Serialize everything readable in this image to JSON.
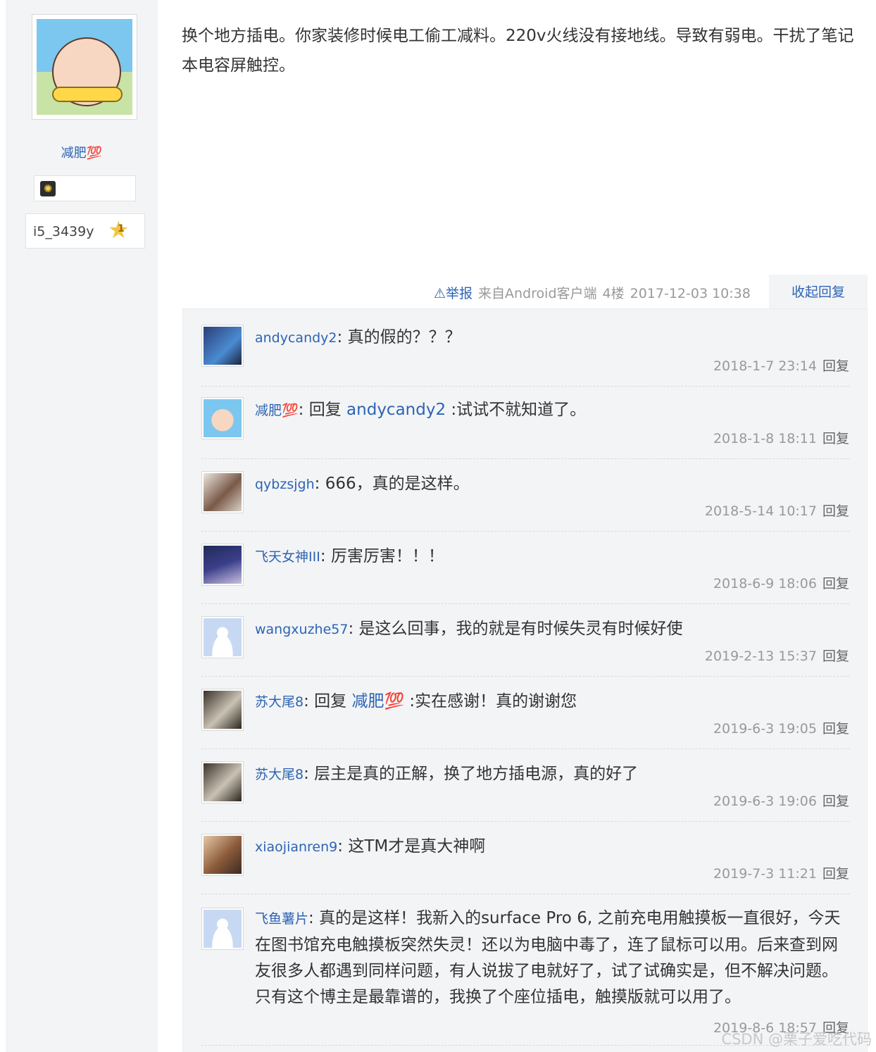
{
  "user": {
    "name": "减肥💯",
    "level_id": "i5_3439y",
    "level_number": "1"
  },
  "post": {
    "content": "换个地方插电。你家装修时候电工偷工减料。220v火线没有接地线。导致有弱电。干扰了笔记本电容屏触控。",
    "report_label": "⚠举报",
    "source": "来自Android客户端",
    "floor": "4楼",
    "time": "2017-12-03 10:38",
    "collapse_label": "收起回复"
  },
  "reply_label": "回复",
  "replies": [
    {
      "user": "andycandy2",
      "prefix": "",
      "target": "",
      "text": "真的假的？？？",
      "time": "2018-1-7 23:14",
      "colors": [
        "#2b3e78",
        "#4a8bd1"
      ]
    },
    {
      "user": "减肥💯",
      "prefix": "回复 ",
      "target": "andycandy2",
      "text": " :试试不就知道了。",
      "time": "2018-1-8 18:11",
      "colors": [
        "#7cc7ef",
        "#f7d7c2"
      ]
    },
    {
      "user": "qybzsjgh",
      "prefix": "",
      "target": "",
      "text": "666，真的是这样。",
      "time": "2018-5-14 10:17",
      "colors": [
        "#d9d0c8",
        "#7a5a48"
      ]
    },
    {
      "user": "飞天女神III",
      "prefix": "",
      "target": "",
      "text": "厉害厉害！！！",
      "time": "2018-6-9 18:06",
      "colors": [
        "#1f2a5a",
        "#c9c1e0"
      ]
    },
    {
      "user": "wangxuzhe57",
      "prefix": "",
      "target": "",
      "text": "是这么回事，我的就是有时候失灵有时候好使",
      "time": "2019-2-13 15:37",
      "colors": [
        "#dce8fa",
        "#bcd0ee"
      ]
    },
    {
      "user": "苏大尾8",
      "prefix": "回复 ",
      "target": "减肥💯",
      "text": " :实在感谢！真的谢谢您",
      "time": "2019-6-3 19:05",
      "colors": [
        "#3a3128",
        "#c9c2b4"
      ]
    },
    {
      "user": "苏大尾8",
      "prefix": "",
      "target": "",
      "text": "层主是真的正解，换了地方插电源，真的好了",
      "time": "2019-6-3 19:06",
      "colors": [
        "#3a3128",
        "#c9c2b4"
      ]
    },
    {
      "user": "xiaojianren9",
      "prefix": "",
      "target": "",
      "text": "这TM才是真大神啊",
      "time": "2019-7-3 11:21",
      "colors": [
        "#8a5a3a",
        "#e6c8a8"
      ]
    },
    {
      "user": "飞鱼薯片",
      "prefix": "",
      "target": "",
      "text": "真的是这样！我新入的surface Pro 6, 之前充电用触摸板一直很好，今天在图书馆充电触摸板突然失灵！还以为电脑中毒了，连了鼠标可以用。后来查到网友很多人都遇到同样问题，有人说拔了电就好了，试了试确实是，但不解决问题。只有这个博主是最靠谱的，我换了个座位插电，触摸版就可以用了。",
      "time": "2019-8-6 18:57",
      "colors": [
        "#dce8fa",
        "#bcd0ee"
      ]
    }
  ],
  "watermark": "CSDN @栗子爱吃代码"
}
